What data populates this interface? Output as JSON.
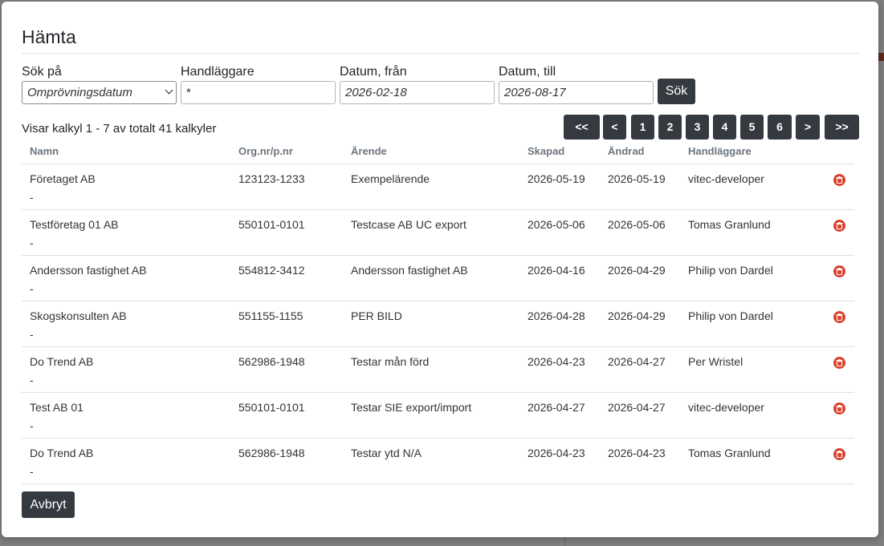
{
  "modal": {
    "title": "Hämta",
    "fields": {
      "search_on": {
        "label": "Sök på",
        "value": "Omprövningsdatum"
      },
      "handler": {
        "label": "Handläggare",
        "value": "*"
      },
      "date_from": {
        "label": "Datum, från",
        "value": "2026-02-18"
      },
      "date_to": {
        "label": "Datum, till",
        "value": "2026-08-17"
      }
    },
    "search_button": "Sök",
    "summary": "Visar kalkyl 1 - 7 av totalt 41 kalkyler",
    "pager": [
      "<<",
      "<",
      "1",
      "2",
      "3",
      "4",
      "5",
      "6",
      ">",
      ">>"
    ],
    "columns": [
      "Namn",
      "Org.nr/p.nr",
      "Ärende",
      "Skapad",
      "Ändrad",
      "Handläggare"
    ],
    "rows": [
      {
        "name": "Företaget AB",
        "sub": "-",
        "org": "123123-1233",
        "case": "Exempelärende",
        "created": "2026-05-19",
        "changed": "2026-05-19",
        "handler": "vitec-developer"
      },
      {
        "name": "Testföretag 01 AB",
        "sub": "-",
        "org": "550101-0101",
        "case": "Testcase AB UC export",
        "created": "2026-05-06",
        "changed": "2026-05-06",
        "handler": "Tomas Granlund"
      },
      {
        "name": "Andersson fastighet AB",
        "sub": "-",
        "org": "554812-3412",
        "case": "Andersson fastighet AB",
        "created": "2026-04-16",
        "changed": "2026-04-29",
        "handler": "Philip von Dardel"
      },
      {
        "name": "Skogskonsulten AB",
        "sub": "-",
        "org": "551155-1155",
        "case": "PER BILD",
        "created": "2026-04-28",
        "changed": "2026-04-29",
        "handler": "Philip von Dardel"
      },
      {
        "name": "Do Trend AB",
        "sub": "-",
        "org": "562986-1948",
        "case": "Testar mån förd",
        "created": "2026-04-23",
        "changed": "2026-04-27",
        "handler": "Per Wristel"
      },
      {
        "name": "Test AB 01",
        "sub": "-",
        "org": "550101-0101",
        "case": "Testar SIE export/import",
        "created": "2026-04-27",
        "changed": "2026-04-27",
        "handler": "vitec-developer"
      },
      {
        "name": "Do Trend AB",
        "sub": "-",
        "org": "562986-1948",
        "case": "Testar ytd N/A",
        "created": "2026-04-23",
        "changed": "2026-04-23",
        "handler": "Tomas Granlund"
      }
    ],
    "cancel_button": "Avbryt",
    "icons": {
      "delete": "trash-icon",
      "dropdown": "chevron-down-icon"
    },
    "colors": {
      "dark_button": "#343a40",
      "delete": "#d9412e",
      "header_text": "#6c757d"
    }
  }
}
